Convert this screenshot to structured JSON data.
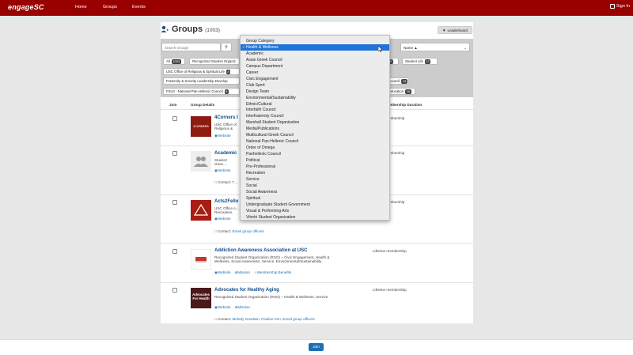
{
  "nav": {
    "logo": "engageSC",
    "links": [
      "Home",
      "Groups",
      "Events"
    ],
    "signin": "Sign In"
  },
  "header": {
    "title": "Groups",
    "count": "(1003)",
    "leaderboard": "Leaderboard"
  },
  "filters": {
    "search_placeholder": "Search Groups",
    "sort_value": "Name ▲",
    "category_selected": "Health & Wellness",
    "chips": [
      {
        "label": "All",
        "count": "1003"
      },
      {
        "label": "Recognized Student Organiz",
        "count": ""
      },
      {
        "label": "",
        "count": "37"
      },
      {
        "label": "Student Life",
        "count": "17"
      },
      {
        "label": "USC Office of Religious & Spiritual Life",
        "count": "4"
      },
      {
        "label": "Fraternity & Sorority Leadership Develop",
        "count": ""
      },
      {
        "label": "Council",
        "count": "13"
      },
      {
        "label": "FSLD - National Pan-Hellenic Council",
        "count": "9"
      },
      {
        "label": "Education",
        "count": "16"
      }
    ]
  },
  "table": {
    "col_join": "Join",
    "col_details": "Group Details",
    "col_membership": "Membership Duration"
  },
  "groups": [
    {
      "name": "4Corners I",
      "desc": "USC Office of Religious & Spiritual Life – Spiritual, Soc",
      "links": [
        "Website"
      ],
      "contact_label": "",
      "contact": "",
      "membership": "membership",
      "thumb_text": "4CORNERS"
    },
    {
      "name": "Academic",
      "desc": "Student Gove… Wellness, Serv…",
      "links": [
        "Website"
      ],
      "contact_label": "Contact:",
      "contact": "T…",
      "membership": "membership",
      "thumb_text": ""
    },
    {
      "name": "Acts2Fello",
      "desc": "USC Office o… Recreation, S…",
      "links": [
        "Website"
      ],
      "contact_label": "Contact:",
      "contact": "Email group officers",
      "membership": "membership",
      "thumb_text": ""
    },
    {
      "name": "Addiction Awareness Association at USC",
      "desc": "Recognized Student Organization (RSO) – Civic Engagement, Health & Wellness, Social Awareness, Service, Environmental/Sustainability",
      "links": [
        "Website",
        "Mission",
        "Membership Benefits"
      ],
      "contact_label": "",
      "contact": "",
      "membership": "Lifetime membership",
      "thumb_text": "AAA"
    },
    {
      "name": "Advocates for Healthy Aging",
      "desc": "Recognized Student Organization (RSO) – Health & Wellness, Service",
      "links": [
        "Website",
        "Mission"
      ],
      "contact_label": "Contact:",
      "contact": "Melody Goodwin, Pauline Kim, Email group officers",
      "membership": "Lifetime membership",
      "thumb_text": "Advocates For Health"
    }
  ],
  "dropdown": {
    "items": [
      "Group Category",
      "Health & Wellness",
      "Academic",
      "Asian Greek Council",
      "Campus Department",
      "Career",
      "Civic Engagement",
      "Club Sport",
      "Design Team",
      "Environmental/Sustainability",
      "Ethnic/Cultural",
      "Interfaith Council",
      "Interfraternity Council",
      "Marshall Student Organization",
      "Media/Publications",
      "Multicultural Greek Council",
      "National Pan-Hellenic Council",
      "Order of Omega",
      "Panhellenic Council",
      "Political",
      "Pre-Professional",
      "Recreation",
      "Service",
      "Social",
      "Social Awareness",
      "Spiritual",
      "Undergraduate Student Government",
      "Visual & Performing Arts",
      "Viterbi Student Organization"
    ],
    "selected_index": 1
  },
  "footer": {
    "join": "Join"
  },
  "colors": {
    "brand": "#990000",
    "accent": "#1f74d8",
    "link": "#1f6fb2"
  }
}
